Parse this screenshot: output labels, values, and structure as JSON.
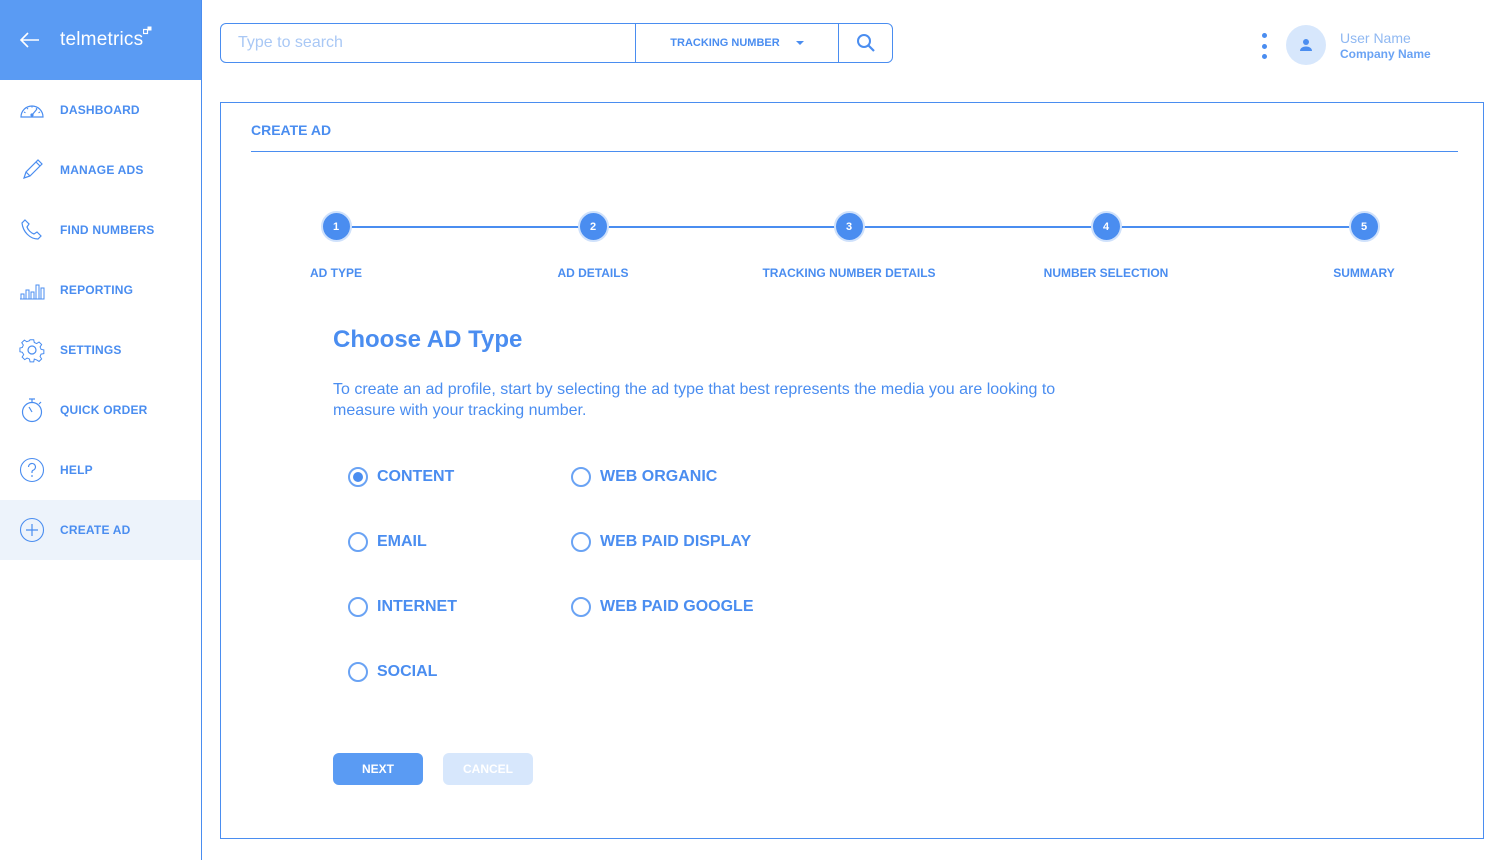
{
  "brand": {
    "name": "telmetrics"
  },
  "sidebar": {
    "items": [
      {
        "label": "DASHBOARD",
        "icon": "dashboard-gauge-icon"
      },
      {
        "label": "MANAGE ADS",
        "icon": "pencil-icon"
      },
      {
        "label": "FIND NUMBERS",
        "icon": "phone-icon"
      },
      {
        "label": "REPORTING",
        "icon": "bar-chart-icon"
      },
      {
        "label": "SETTINGS",
        "icon": "gear-icon"
      },
      {
        "label": "QUICK ORDER",
        "icon": "stopwatch-icon"
      },
      {
        "label": "HELP",
        "icon": "help-circle-icon"
      },
      {
        "label": "CREATE AD",
        "icon": "plus-circle-icon",
        "active": true
      }
    ]
  },
  "search": {
    "placeholder": "Type to search",
    "filter_label": "TRACKING NUMBER"
  },
  "user": {
    "name": "User Name",
    "company": "Company Name"
  },
  "card": {
    "title": "CREATE AD"
  },
  "steps": [
    {
      "num": "1",
      "label": "AD TYPE"
    },
    {
      "num": "2",
      "label": "AD DETAILS"
    },
    {
      "num": "3",
      "label": "TRACKING NUMBER DETAILS"
    },
    {
      "num": "4",
      "label": "NUMBER SELECTION"
    },
    {
      "num": "5",
      "label": "SUMMARY"
    }
  ],
  "content": {
    "heading": "Choose AD Type",
    "description": "To create an ad profile, start by selecting the ad type that best represents the media you are looking to measure with your tracking number."
  },
  "ad_types": [
    {
      "label": "CONTENT",
      "selected": true
    },
    {
      "label": "EMAIL",
      "selected": false
    },
    {
      "label": "INTERNET",
      "selected": false
    },
    {
      "label": "SOCIAL",
      "selected": false
    },
    {
      "label": "WEB ORGANIC",
      "selected": false
    },
    {
      "label": "WEB PAID DISPLAY",
      "selected": false
    },
    {
      "label": "WEB PAID GOOGLE",
      "selected": false
    }
  ],
  "buttons": {
    "next": "NEXT",
    "cancel": "CANCEL"
  },
  "colors": {
    "accent": "#4a8df0",
    "brand_bar": "#5a9bf3",
    "active_bg": "#edf3fb",
    "disabled": "#d7e7fc"
  }
}
